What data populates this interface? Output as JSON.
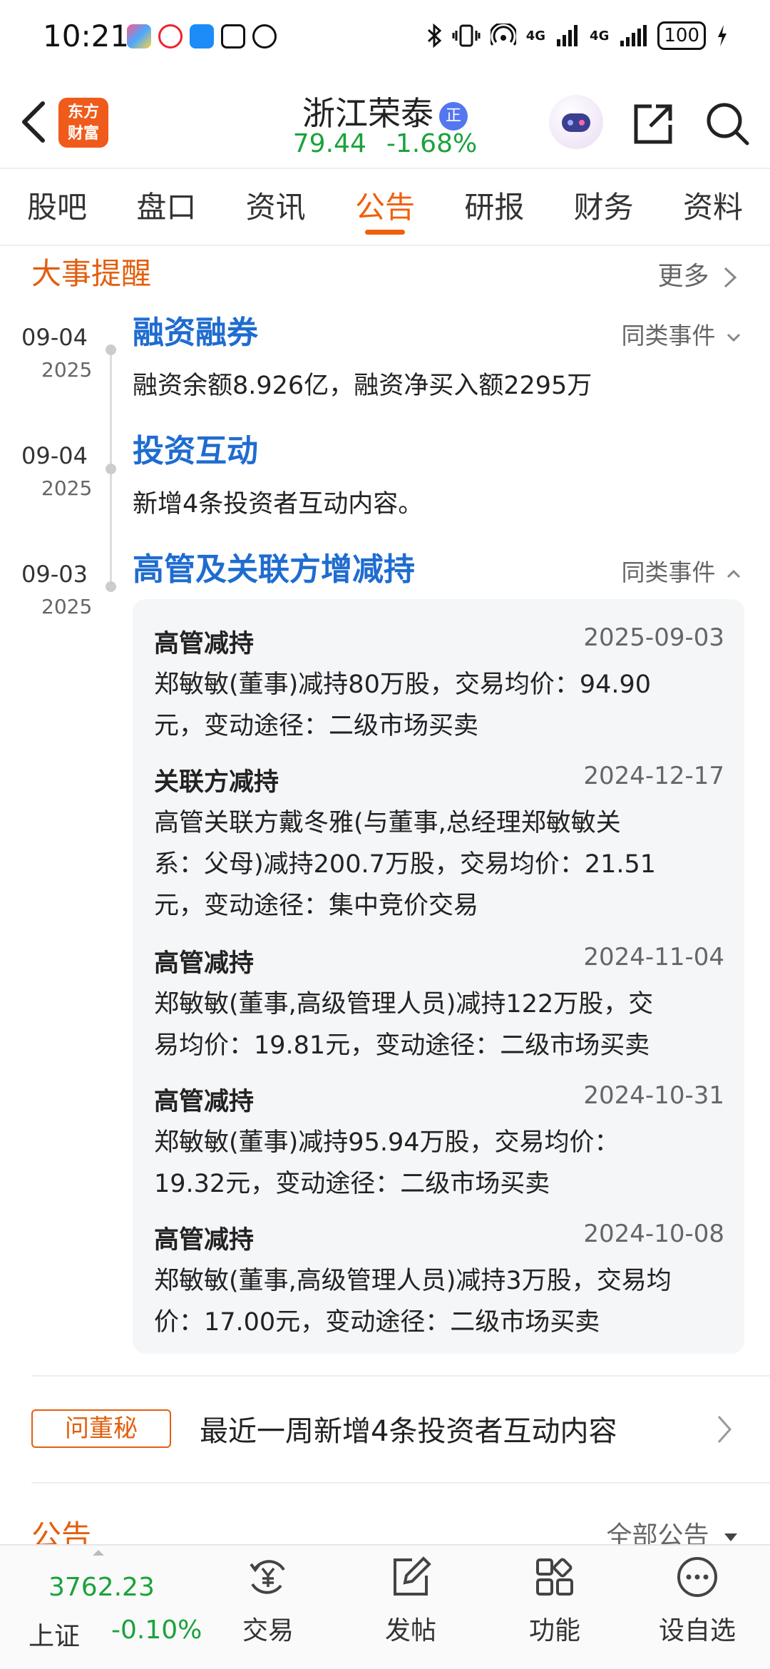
{
  "status_bar": {
    "time": "10:21",
    "network_1": "4G",
    "network_2": "4G",
    "battery": "100"
  },
  "header": {
    "logo_line1": "东方",
    "logo_line2": "财富",
    "stock_name": "浙江荣泰",
    "badge": "正",
    "price": "79.44",
    "change": "-1.68%"
  },
  "tabs": [
    {
      "label": "股吧"
    },
    {
      "label": "盘口"
    },
    {
      "label": "资讯"
    },
    {
      "label": "公告",
      "active": true
    },
    {
      "label": "研报"
    },
    {
      "label": "财务"
    },
    {
      "label": "资料"
    }
  ],
  "events_section": {
    "title": "大事提醒",
    "more": "更多"
  },
  "events": [
    {
      "date": "09-04",
      "year": "2025",
      "title": "融资融券",
      "similar": "同类事件",
      "desc": "融资余额8.926亿，融资净买入额2295万"
    },
    {
      "date": "09-04",
      "year": "2025",
      "title": "投资互动",
      "desc": "新增4条投资者互动内容。"
    },
    {
      "date": "09-03",
      "year": "2025",
      "title": "高管及关联方增减持",
      "similar": "同类事件"
    }
  ],
  "details": [
    {
      "type": "高管减持",
      "date": "2025-09-03",
      "line1": "郑敏敏(董事)减持80万股，交易均价：94.90",
      "line2": "元，变动途径：二级市场买卖"
    },
    {
      "type": "关联方减持",
      "date": "2024-12-17",
      "line1": "高管关联方戴冬雅(与董事,总经理郑敏敏关",
      "line2": "系：父母)减持200.7万股，交易均价：21.51",
      "line3": "元，变动途径：集中竞价交易"
    },
    {
      "type": "高管减持",
      "date": "2024-11-04",
      "line1": "郑敏敏(董事,高级管理人员)减持122万股，交",
      "line2": "易均价：19.81元，变动途径：二级市场买卖"
    },
    {
      "type": "高管减持",
      "date": "2024-10-31",
      "line1": "郑敏敏(董事)减持95.94万股，交易均价：",
      "line2": "19.32元，变动途径：二级市场买卖"
    },
    {
      "type": "高管减持",
      "date": "2024-10-08",
      "line1": "郑敏敏(董事,高级管理人员)减持3万股，交易均",
      "line2": "价：17.00元，变动途径：二级市场买卖"
    }
  ],
  "secretary": {
    "tag": "问董秘",
    "text": "最近一周新增4条投资者互动内容"
  },
  "announcements": {
    "title": "公告",
    "all": "全部公告"
  },
  "bottom_bar": {
    "index_value": "3762.23",
    "index_name": "上证",
    "index_change": "-0.10%",
    "nav": [
      {
        "label": "交易"
      },
      {
        "label": "发帖"
      },
      {
        "label": "功能"
      },
      {
        "label": "设自选"
      }
    ]
  },
  "colors": {
    "accent": "#f0600c",
    "link_blue": "#1f6cd0",
    "down_green": "#1aa23c"
  }
}
